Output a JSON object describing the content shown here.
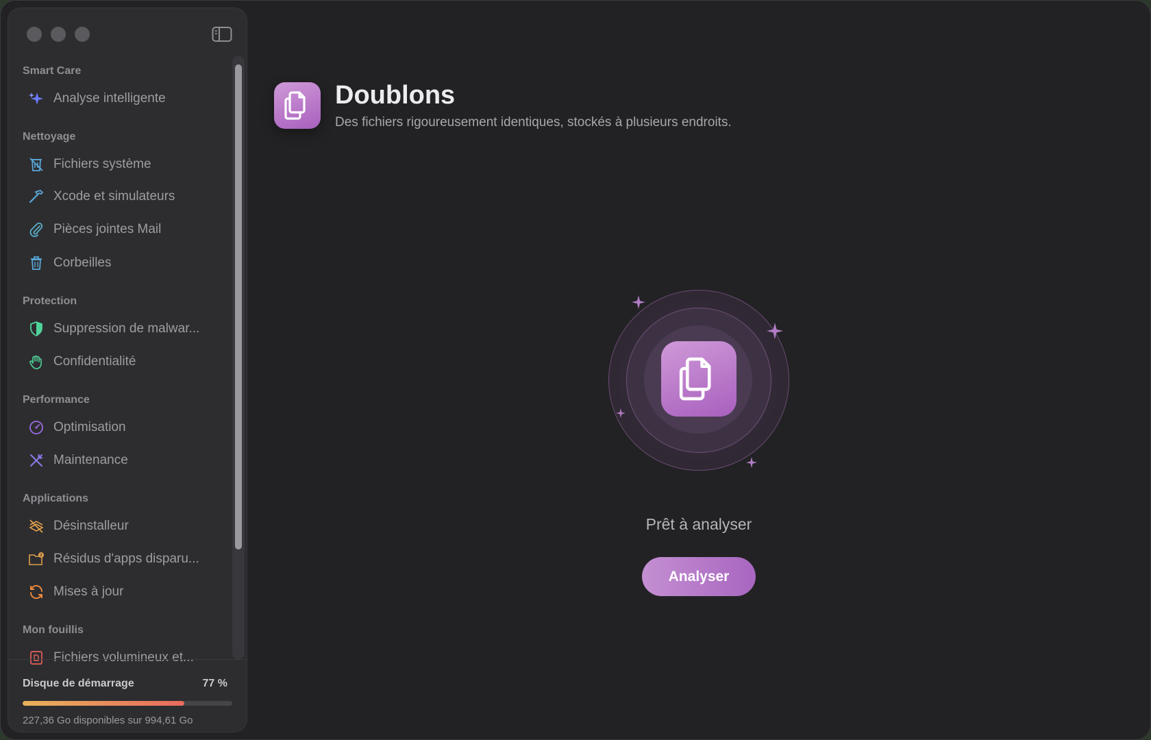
{
  "sidebar": {
    "sections": [
      {
        "title": "Smart Care",
        "items": [
          {
            "label": "Analyse intelligente",
            "icon": "sparkles-icon"
          }
        ]
      },
      {
        "title": "Nettoyage",
        "items": [
          {
            "label": "Fichiers système",
            "icon": "system-files-icon"
          },
          {
            "label": "Xcode et simulateurs",
            "icon": "hammer-icon"
          },
          {
            "label": "Pièces jointes Mail",
            "icon": "paperclip-icon"
          },
          {
            "label": "Corbeilles",
            "icon": "trash-icon"
          }
        ]
      },
      {
        "title": "Protection",
        "items": [
          {
            "label": "Suppression de malwar...",
            "icon": "shield-icon"
          },
          {
            "label": "Confidentialité",
            "icon": "hand-icon"
          }
        ]
      },
      {
        "title": "Performance",
        "items": [
          {
            "label": "Optimisation",
            "icon": "gauge-icon"
          },
          {
            "label": "Maintenance",
            "icon": "tools-icon"
          }
        ]
      },
      {
        "title": "Applications",
        "items": [
          {
            "label": "Désinstalleur",
            "icon": "uninstaller-icon"
          },
          {
            "label": "Résidus d'apps disparu...",
            "icon": "leftovers-folder-icon"
          },
          {
            "label": "Mises à jour",
            "icon": "refresh-icon"
          }
        ]
      },
      {
        "title": "Mon fouillis",
        "items": [
          {
            "label": "Fichiers volumineux et...",
            "icon": "large-files-icon"
          }
        ]
      }
    ],
    "disk": {
      "title": "Disque de démarrage",
      "percent_label": "77 %",
      "used_fraction": 0.77,
      "info": "227,36 Go disponibles sur 994,61 Go"
    }
  },
  "main": {
    "title": "Doublons",
    "subtitle": "Des fichiers rigoureusement identiques, stockés à plusieurs endroits.",
    "status": "Prêt à analyser",
    "scan_button": "Analyser"
  },
  "colors": {
    "accent": "#b478c8",
    "sidebar_bg": "#2d2d30",
    "window_bg": "#222224"
  }
}
